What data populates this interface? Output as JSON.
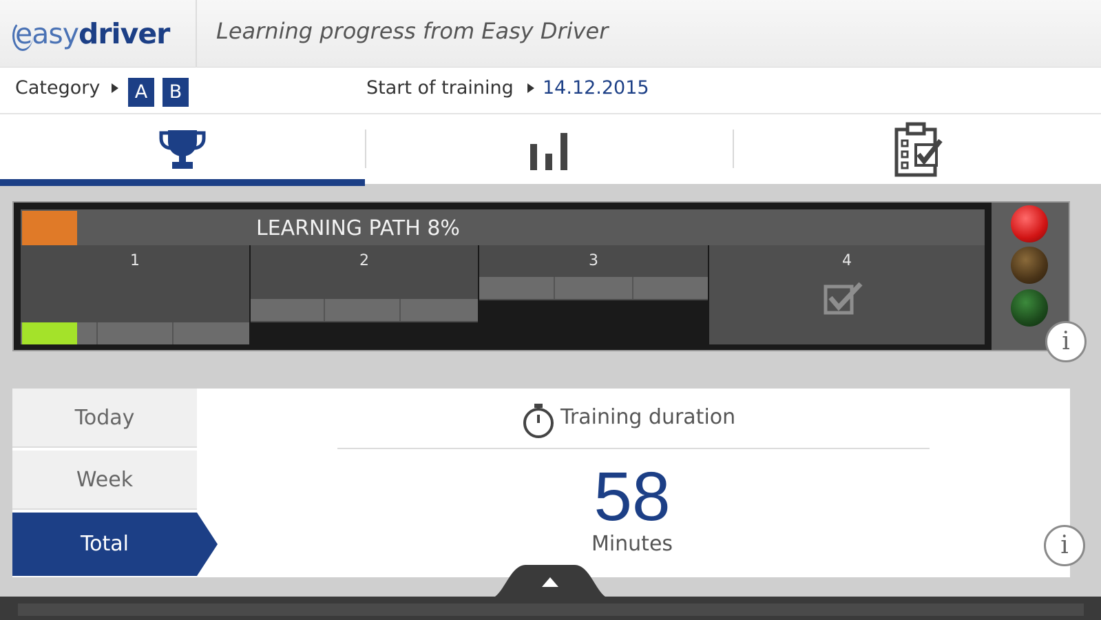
{
  "header": {
    "logo_easy": "easy",
    "logo_driver": "driver",
    "title": "Learning progress from Easy Driver"
  },
  "infobar": {
    "category_label": "Category",
    "categories": [
      "A",
      "B"
    ],
    "start_label": "Start of training",
    "start_date": "14.12.2015"
  },
  "tabs": [
    {
      "icon": "trophy-icon",
      "active": true
    },
    {
      "icon": "bar-chart-icon",
      "active": false
    },
    {
      "icon": "checklist-icon",
      "active": false
    }
  ],
  "learning_path": {
    "title": "LEARNING PATH 8%",
    "percent": 8,
    "stages": [
      "1",
      "2",
      "3",
      "4"
    ],
    "colors": {
      "orange": "#e07a28",
      "green": "#a4e22a"
    }
  },
  "traffic_light": {
    "active": "red"
  },
  "duration": {
    "ranges": [
      "Today",
      "Week",
      "Total"
    ],
    "selected": "Total",
    "title": "Training duration",
    "value": "58",
    "unit": "Minutes"
  },
  "colors": {
    "brand": "#1c3f86",
    "accent": "#4a72b5"
  }
}
